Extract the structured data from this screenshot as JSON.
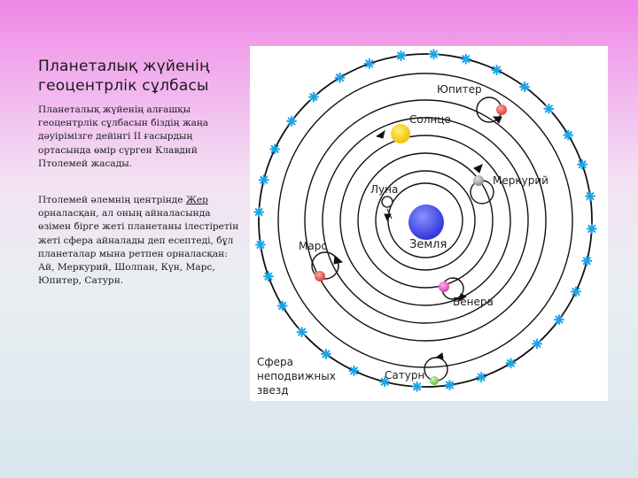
{
  "title": "Планеталық жүйенің геоцентрлік сұлбасы",
  "paragraph1": "Планеталық жүйенің алғашқы геоцентрлік сұлбасын біздің жаңа дәуірімізге дейінгі ІІ ғасырдың ортасында өмір сүрген Клавдий Птолемей жасады.",
  "paragraph2": {
    "before": "Птолемей әлемнің центрінде ",
    "highlight": "Жер ",
    "after": " орналасқан, ал оның айналасында өзімен бірге жеті планетаны ілестіретін жеті сфера айналады деп есептеді, бұл планеталар мына ретпен орналасқан: Ай, Меркурий, Шолпан, Күн, Марс, Юпитер, Сатурн."
  },
  "diagram": {
    "labels": {
      "earth": "Земля",
      "moon": "Луна",
      "mercury": "Меркурий",
      "venus": "Венера",
      "sun": "Солнце",
      "mars": "Марс",
      "jupiter": "Юпитер",
      "saturn": "Сатурн",
      "fixed_stars": [
        "Сфера",
        "неподвижных",
        "звезд"
      ]
    },
    "colors": {
      "earth": "#3f48e6",
      "sun": "#f6d214",
      "mars": "#e2524e",
      "jupiter": "#e2524e",
      "venus": "#e255c4",
      "mercury": "#9aa0a8",
      "saturn": "#7fc85a",
      "stars": "#1aa4e8",
      "orbits": "#111111"
    }
  }
}
